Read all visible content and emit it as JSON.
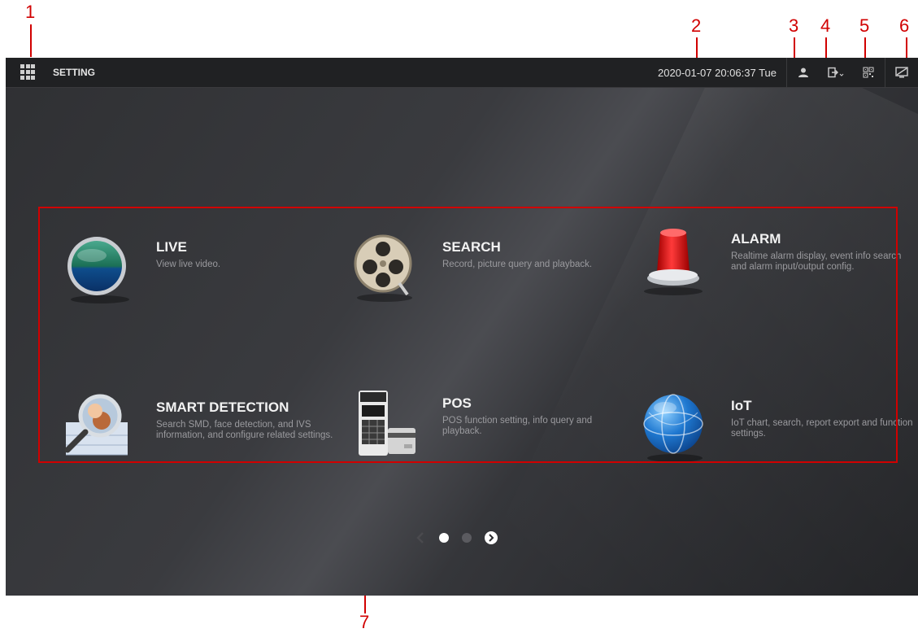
{
  "callouts": [
    "1",
    "2",
    "3",
    "4",
    "5",
    "6",
    "7"
  ],
  "header": {
    "title": "SETTING",
    "datetime": "2020-01-07 20:06:37 Tue"
  },
  "icons": {
    "menu": "grid-menu-icon",
    "user": "user-icon",
    "logout": "logout-icon",
    "qrcode": "qr-code-icon",
    "screen": "display-icon"
  },
  "tiles": [
    {
      "name": "LIVE",
      "desc": "View live video.",
      "icon": "live-icon"
    },
    {
      "name": "SEARCH",
      "desc": "Record, picture query and playback.",
      "icon": "search-reel-icon"
    },
    {
      "name": "ALARM",
      "desc": "Realtime alarm display, event info search and alarm input/output config.",
      "icon": "alarm-light-icon"
    },
    {
      "name": "SMART DETECTION",
      "desc": "Search SMD, face detection, and IVS information, and configure related settings.",
      "icon": "smart-detection-icon"
    },
    {
      "name": "POS",
      "desc": "POS function setting, info query and playback.",
      "icon": "pos-terminal-icon"
    },
    {
      "name": "IoT",
      "desc": "IoT chart, search, report export and function settings.",
      "icon": "globe-icon"
    }
  ],
  "pager": {
    "pages": 2,
    "current": 1
  },
  "colors": {
    "annotation": "#d10000",
    "topbar": "#202123"
  }
}
